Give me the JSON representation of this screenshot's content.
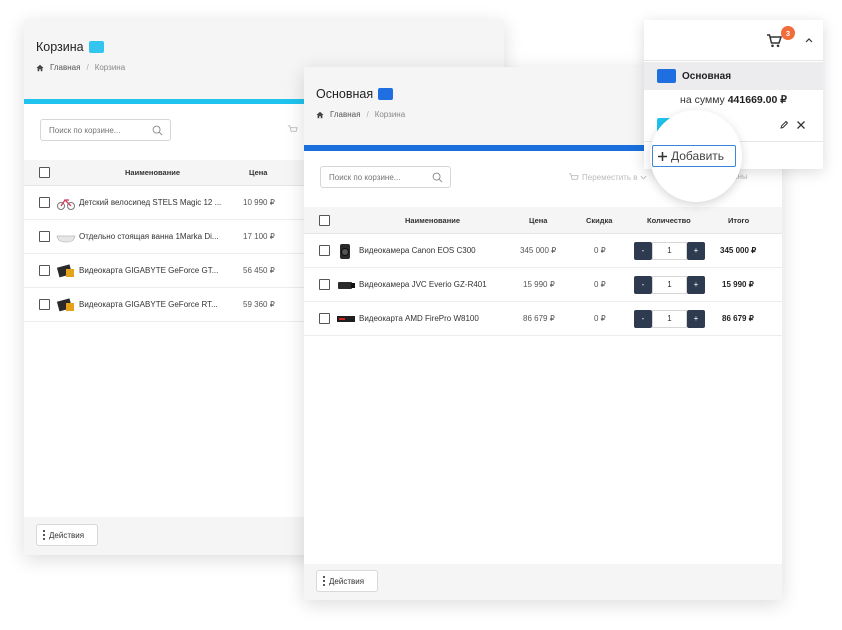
{
  "back_window": {
    "title": "Корзина",
    "title_swatch_color": "#33c5ef",
    "breadcrumb": {
      "home": "Главная",
      "current": "Корзина"
    },
    "accent_bar_color": "#1fc3ee",
    "search_placeholder": "Поиск по корзине...",
    "columns": {
      "name": "Наименование",
      "price": "Цена"
    },
    "rows": [
      {
        "name": "Детский велосипед STELS Magic 12 ...",
        "price": "10 990 ₽",
        "thumb": "bicycle"
      },
      {
        "name": "Отдельно стоящая ванна 1Marka Di...",
        "price": "17 100 ₽",
        "thumb": "bathtub"
      },
      {
        "name": "Видеокарта GIGABYTE GeForce GT...",
        "price": "56 450 ₽",
        "thumb": "gpu"
      },
      {
        "name": "Видеокарта GIGABYTE GeForce RT...",
        "price": "59 360 ₽",
        "thumb": "gpu"
      }
    ],
    "actions_label": "Действия"
  },
  "front_window": {
    "title": "Основная",
    "title_swatch_color": "#1f6fe0",
    "breadcrumb": {
      "home": "Главная",
      "current": "Корзина"
    },
    "accent_bar_color": "#1a6fdc",
    "search_placeholder": "Поиск по корзине...",
    "move_label": "Переместить в",
    "clear_label": "ины",
    "columns": {
      "name": "Наименование",
      "price": "Цена",
      "discount": "Скидка",
      "qty": "Количество",
      "total": "Итого"
    },
    "rows": [
      {
        "name": "Видеокамера Canon EOS C300",
        "price": "345 000 ₽",
        "discount": "0 ₽",
        "qty": "1",
        "total": "345 000 ₽",
        "thumb": "camera"
      },
      {
        "name": "Видеокамера JVC Everio GZ-R401",
        "price": "15 990 ₽",
        "discount": "0 ₽",
        "qty": "1",
        "total": "15 990 ₽",
        "thumb": "camcorder"
      },
      {
        "name": "Видеокарта AMD FirePro W8100",
        "price": "86 679 ₽",
        "discount": "0 ₽",
        "qty": "1",
        "total": "86 679 ₽",
        "thumb": "gpu-card"
      }
    ],
    "qty_minus": "-",
    "qty_plus": "+",
    "actions_label": "Действия"
  },
  "mini_cart": {
    "badge_count": "3",
    "cart_name": "Основная",
    "cart_swatch_color": "#1f6fe0",
    "second_swatch_color": "#1fc3ee",
    "sum_prefix": "на сумму",
    "sum_value": "441669.00 ₽",
    "add_label": "Добавить"
  },
  "icons": [
    "home-icon",
    "search-icon",
    "cart-icon",
    "chevron-up-icon",
    "edit-icon",
    "close-icon",
    "plus-icon",
    "more-vertical-icon",
    "checkbox-icon"
  ]
}
